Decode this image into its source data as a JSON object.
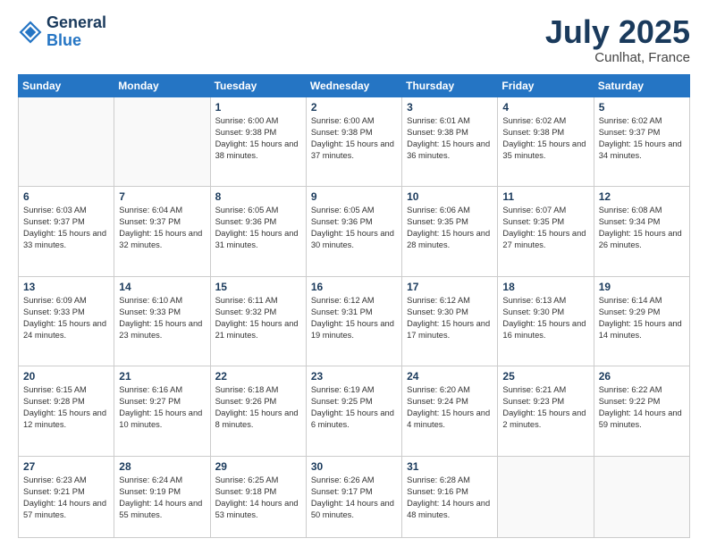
{
  "header": {
    "logo_line1": "General",
    "logo_line2": "Blue",
    "month_year": "July 2025",
    "location": "Cunlhat, France"
  },
  "weekdays": [
    "Sunday",
    "Monday",
    "Tuesday",
    "Wednesday",
    "Thursday",
    "Friday",
    "Saturday"
  ],
  "weeks": [
    [
      {
        "day": "",
        "empty": true
      },
      {
        "day": "",
        "empty": true
      },
      {
        "day": "1",
        "sunrise": "6:00 AM",
        "sunset": "9:38 PM",
        "daylight": "15 hours and 38 minutes."
      },
      {
        "day": "2",
        "sunrise": "6:00 AM",
        "sunset": "9:38 PM",
        "daylight": "15 hours and 37 minutes."
      },
      {
        "day": "3",
        "sunrise": "6:01 AM",
        "sunset": "9:38 PM",
        "daylight": "15 hours and 36 minutes."
      },
      {
        "day": "4",
        "sunrise": "6:02 AM",
        "sunset": "9:38 PM",
        "daylight": "15 hours and 35 minutes."
      },
      {
        "day": "5",
        "sunrise": "6:02 AM",
        "sunset": "9:37 PM",
        "daylight": "15 hours and 34 minutes."
      }
    ],
    [
      {
        "day": "6",
        "sunrise": "6:03 AM",
        "sunset": "9:37 PM",
        "daylight": "15 hours and 33 minutes."
      },
      {
        "day": "7",
        "sunrise": "6:04 AM",
        "sunset": "9:37 PM",
        "daylight": "15 hours and 32 minutes."
      },
      {
        "day": "8",
        "sunrise": "6:05 AM",
        "sunset": "9:36 PM",
        "daylight": "15 hours and 31 minutes."
      },
      {
        "day": "9",
        "sunrise": "6:05 AM",
        "sunset": "9:36 PM",
        "daylight": "15 hours and 30 minutes."
      },
      {
        "day": "10",
        "sunrise": "6:06 AM",
        "sunset": "9:35 PM",
        "daylight": "15 hours and 28 minutes."
      },
      {
        "day": "11",
        "sunrise": "6:07 AM",
        "sunset": "9:35 PM",
        "daylight": "15 hours and 27 minutes."
      },
      {
        "day": "12",
        "sunrise": "6:08 AM",
        "sunset": "9:34 PM",
        "daylight": "15 hours and 26 minutes."
      }
    ],
    [
      {
        "day": "13",
        "sunrise": "6:09 AM",
        "sunset": "9:33 PM",
        "daylight": "15 hours and 24 minutes."
      },
      {
        "day": "14",
        "sunrise": "6:10 AM",
        "sunset": "9:33 PM",
        "daylight": "15 hours and 23 minutes."
      },
      {
        "day": "15",
        "sunrise": "6:11 AM",
        "sunset": "9:32 PM",
        "daylight": "15 hours and 21 minutes."
      },
      {
        "day": "16",
        "sunrise": "6:12 AM",
        "sunset": "9:31 PM",
        "daylight": "15 hours and 19 minutes."
      },
      {
        "day": "17",
        "sunrise": "6:12 AM",
        "sunset": "9:30 PM",
        "daylight": "15 hours and 17 minutes."
      },
      {
        "day": "18",
        "sunrise": "6:13 AM",
        "sunset": "9:30 PM",
        "daylight": "15 hours and 16 minutes."
      },
      {
        "day": "19",
        "sunrise": "6:14 AM",
        "sunset": "9:29 PM",
        "daylight": "15 hours and 14 minutes."
      }
    ],
    [
      {
        "day": "20",
        "sunrise": "6:15 AM",
        "sunset": "9:28 PM",
        "daylight": "15 hours and 12 minutes."
      },
      {
        "day": "21",
        "sunrise": "6:16 AM",
        "sunset": "9:27 PM",
        "daylight": "15 hours and 10 minutes."
      },
      {
        "day": "22",
        "sunrise": "6:18 AM",
        "sunset": "9:26 PM",
        "daylight": "15 hours and 8 minutes."
      },
      {
        "day": "23",
        "sunrise": "6:19 AM",
        "sunset": "9:25 PM",
        "daylight": "15 hours and 6 minutes."
      },
      {
        "day": "24",
        "sunrise": "6:20 AM",
        "sunset": "9:24 PM",
        "daylight": "15 hours and 4 minutes."
      },
      {
        "day": "25",
        "sunrise": "6:21 AM",
        "sunset": "9:23 PM",
        "daylight": "15 hours and 2 minutes."
      },
      {
        "day": "26",
        "sunrise": "6:22 AM",
        "sunset": "9:22 PM",
        "daylight": "14 hours and 59 minutes."
      }
    ],
    [
      {
        "day": "27",
        "sunrise": "6:23 AM",
        "sunset": "9:21 PM",
        "daylight": "14 hours and 57 minutes."
      },
      {
        "day": "28",
        "sunrise": "6:24 AM",
        "sunset": "9:19 PM",
        "daylight": "14 hours and 55 minutes."
      },
      {
        "day": "29",
        "sunrise": "6:25 AM",
        "sunset": "9:18 PM",
        "daylight": "14 hours and 53 minutes."
      },
      {
        "day": "30",
        "sunrise": "6:26 AM",
        "sunset": "9:17 PM",
        "daylight": "14 hours and 50 minutes."
      },
      {
        "day": "31",
        "sunrise": "6:28 AM",
        "sunset": "9:16 PM",
        "daylight": "14 hours and 48 minutes."
      },
      {
        "day": "",
        "empty": true
      },
      {
        "day": "",
        "empty": true
      }
    ]
  ]
}
